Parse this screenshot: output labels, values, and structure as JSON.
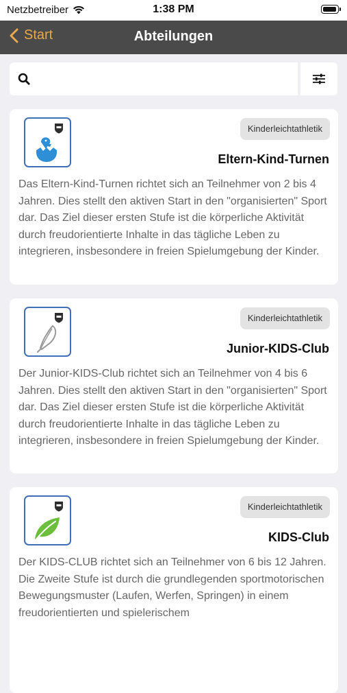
{
  "status_bar": {
    "carrier": "Netzbetreiber",
    "time": "1:38 PM"
  },
  "nav": {
    "back_label": "Start",
    "title": "Abteilungen"
  },
  "search": {
    "placeholder": "",
    "value": ""
  },
  "cards": [
    {
      "tag": "Kinderleichtathletik",
      "title": "Eltern-Kind-Turnen",
      "description": "Das Eltern-Kind-Turnen richtet sich an Teilnehmer von 2 bis 4 Jahren. Dies stellt den aktiven Start in den \"organisierten\" Sport dar. Das Ziel dieser ersten Stufe  ist die körperliche Aktivität durch freudorientierte Inhalte in das tägliche Leben zu integrieren, insbesondere in freien Spielumgebung der Kinder.",
      "icon": "dino-egg-icon",
      "icon_color": "#2e8fd6"
    },
    {
      "tag": "Kinderleichtathletik",
      "title": "Junior-KIDS-Club",
      "description": "Der Junior-KIDS-Club richtet sich an Teilnehmer von 4 bis 6 Jahren. Dies stellt den aktiven Start in den \"organisierten\" Sport dar. Das Ziel dieser ersten Stufe  ist die körperliche Aktivität durch freudorientierte Inhalte in das tägliche Leben zu integrieren, insbesondere in freien Spielumgebung der Kinder.",
      "icon": "feather-icon",
      "icon_color": "#9a9a9a"
    },
    {
      "tag": "Kinderleichtathletik",
      "title": "KIDS-Club",
      "description": "Der KIDS-CLUB richtet sich an Teilnehmer von 6 bis  12 Jahren. Die Zweite Stufe ist durch die grundlegenden sportmotorischen Bewegungsmuster (Laufen, Werfen, Springen) in einem freudorientierten und spielerischem",
      "icon": "leaf-icon",
      "icon_color": "#6cbf3c"
    }
  ],
  "colors": {
    "nav_bg": "#4a4a4a",
    "accent": "#e8a94e",
    "logo_border": "#3f6fb6"
  }
}
